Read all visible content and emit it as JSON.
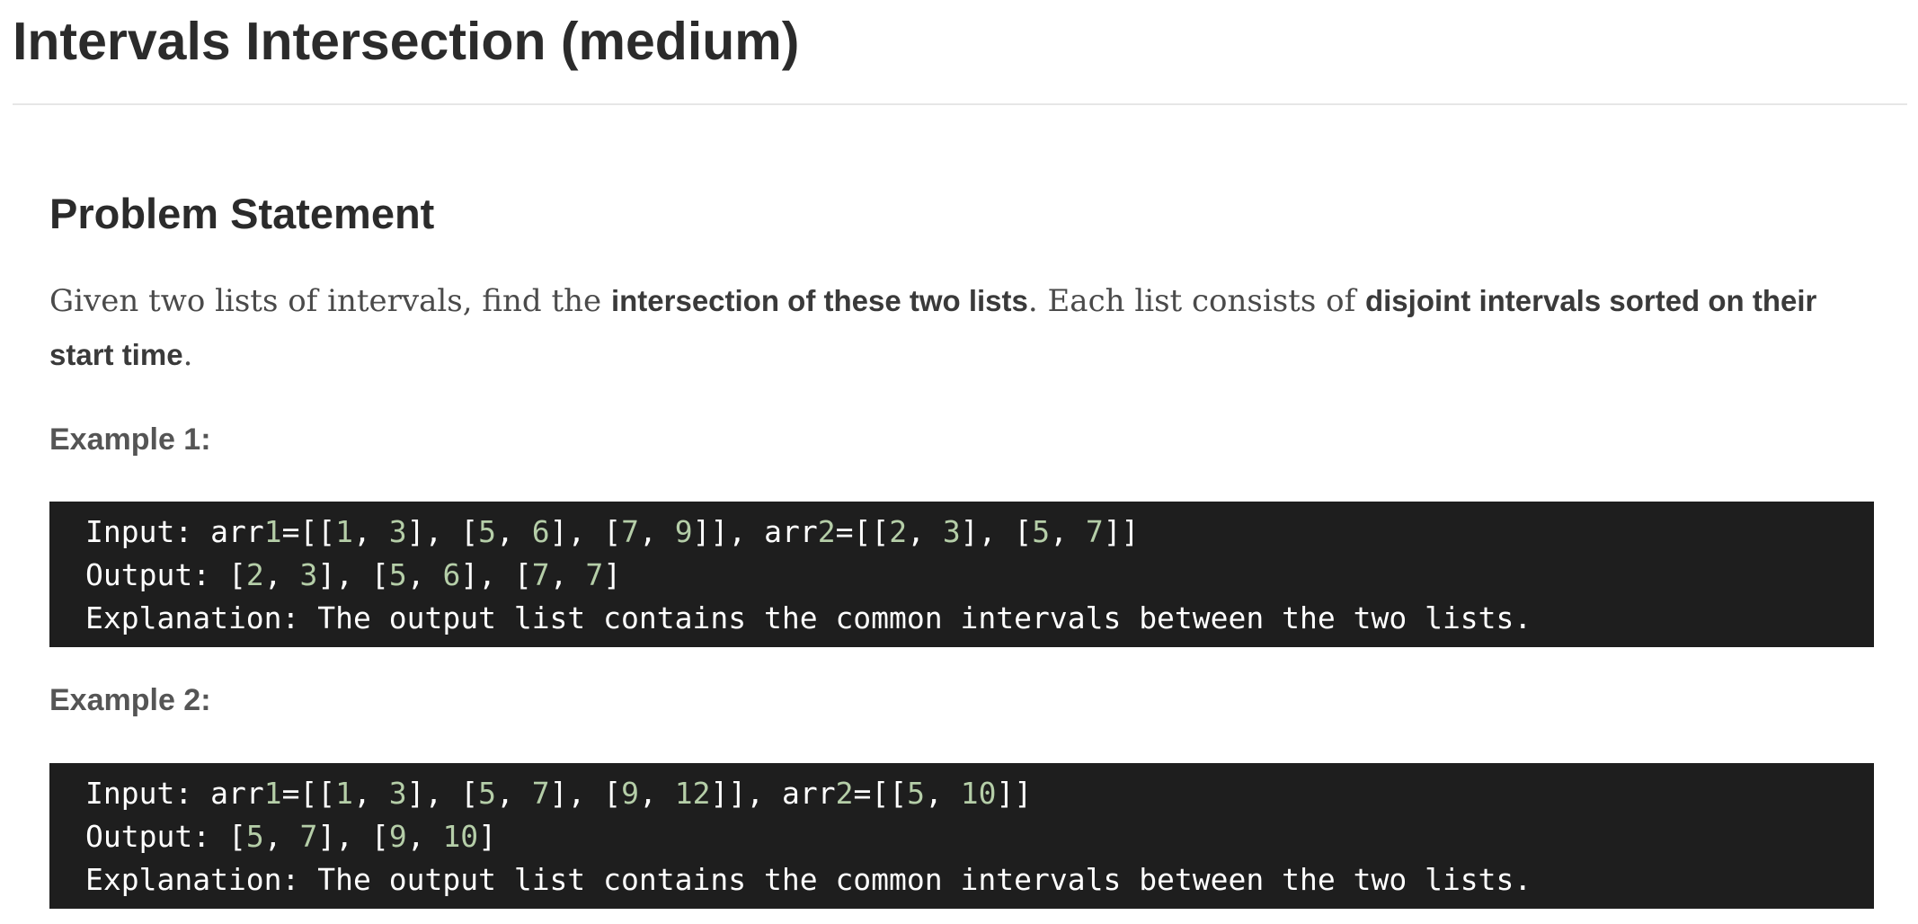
{
  "page": {
    "title": "Intervals Intersection (medium)"
  },
  "problem": {
    "heading": "Problem Statement",
    "statement": {
      "part1": "Given two lists of intervals, find the ",
      "bold1": "intersection of these two lists",
      "part2": ". Each list consists of ",
      "bold2": "disjoint intervals sorted on their start time",
      "part3": "."
    }
  },
  "examples": [
    {
      "heading": "Example 1:",
      "input_label": "Input: ",
      "input_value": "arr1=[[1, 3], [5, 6], [7, 9]], arr2=[[2, 3], [5, 7]]",
      "output_label": "Output: ",
      "output_value": "[2, 3], [5, 6], [7, 7]",
      "explanation": "Explanation: The output list contains the common intervals between the two lists."
    },
    {
      "heading": "Example 2:",
      "input_label": "Input: ",
      "input_value": "arr1=[[1, 3], [5, 7], [9, 12]], arr2=[[5, 10]]",
      "output_label": "Output: ",
      "output_value": "[5, 7], [9, 10]",
      "explanation": "Explanation: The output list contains the common intervals between the two lists."
    }
  ],
  "colors": {
    "code_background": "#1e1e1e",
    "code_text": "#ffffff",
    "code_number": "#b5cea8",
    "heading_text": "#2b2b2b",
    "body_text": "#4a4a4a"
  }
}
